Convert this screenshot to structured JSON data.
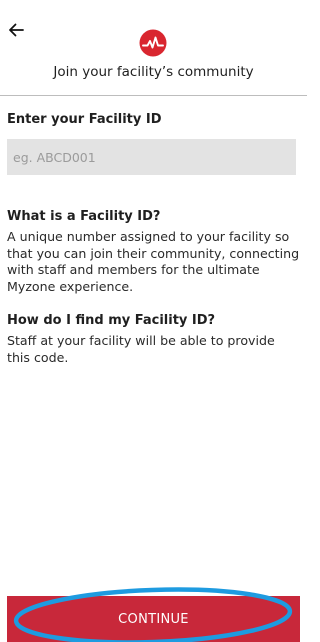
{
  "header": {
    "back_icon": "arrow-left-icon",
    "logo_icon": "myzone-heartbeat-logo-icon",
    "title": "Join your facility’s community",
    "brand_color": "#d9262f"
  },
  "form": {
    "label": "Enter your Facility ID",
    "placeholder": "eg. ABCD001",
    "value": ""
  },
  "faq": [
    {
      "question": "What is a Facility ID?",
      "answer": "A unique number assigned to your facility so that you can join their community, connecting with staff and members for the ultimate Myzone experience."
    },
    {
      "question": "How do I find my Facility ID?",
      "answer": "Staff at your facility will be able to provide this code."
    }
  ],
  "footer": {
    "continue_label": "CONTINUE",
    "button_color": "#c8283a",
    "highlight_color": "#1e9be0"
  }
}
